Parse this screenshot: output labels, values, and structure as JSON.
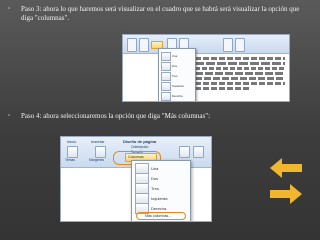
{
  "steps": [
    {
      "bullet": "▫",
      "text": "Paso 3: ahora lo que haremos será visualizar en el cuadro que se habrá será visualizar la opción que diga \"columnas\"."
    },
    {
      "bullet": "▫",
      "text": "Paso 4: ahora seleccionaremos la opción que diga \"Más columnas\":"
    }
  ],
  "screenshot1": {
    "menu_items": [
      "Una",
      "Dos",
      "Tres",
      "Izquierda",
      "Derecha"
    ]
  },
  "screenshot2": {
    "tabs": [
      "Inicio",
      "Insertar",
      "Diseño de página"
    ],
    "buttons": [
      "Temas",
      "Márgenes",
      "Columnas"
    ],
    "side_items": [
      "Orientación",
      "Tamaño",
      "Columnas"
    ],
    "menu_items": [
      "Una",
      "Dos",
      "Tres",
      "Izquierda",
      "Derecha"
    ],
    "more_columns": "Más columnas..."
  },
  "colors": {
    "accent": "#e48a1d",
    "arrow": "#f0b62e",
    "background": "#3d3d3d"
  }
}
